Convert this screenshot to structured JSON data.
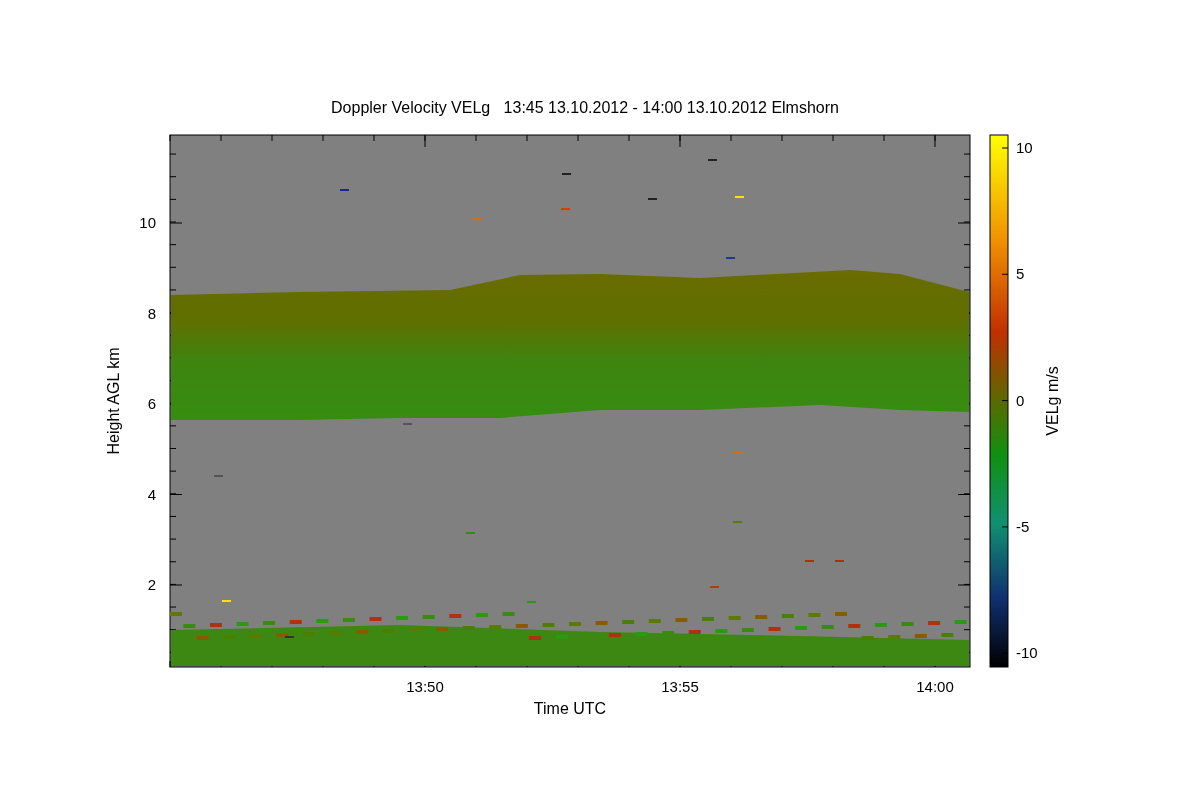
{
  "plot": {
    "title": "Doppler Velocity VELg   13:45 13.10.2012 - 14:00 13.10.2012 Elmshorn",
    "xlabel": "Time UTC",
    "ylabel": "Height AGL km",
    "xticks": [
      "13:50",
      "13:55",
      "14:00"
    ],
    "yticks": [
      "10",
      "8",
      "6",
      "4",
      "2"
    ],
    "colorbar": {
      "label": "VELg m/s",
      "ticks": [
        "10",
        "5",
        "0",
        "-5",
        "-10"
      ]
    }
  }
}
